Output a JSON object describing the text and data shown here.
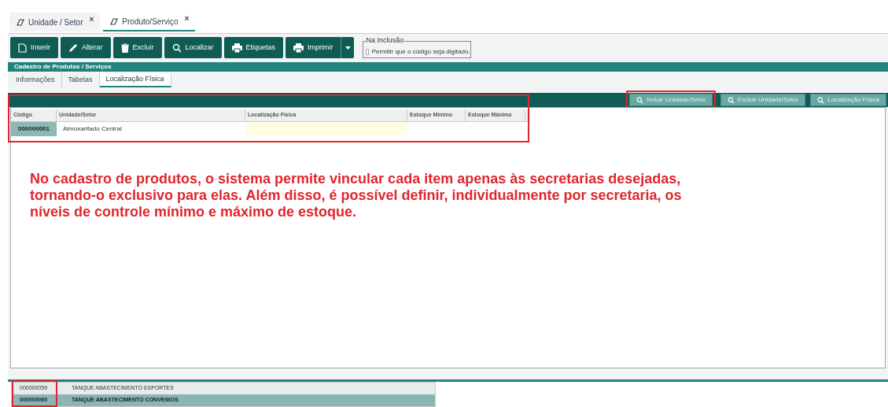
{
  "doc_tabs": [
    {
      "label": "Unidade / Setor",
      "close": "×",
      "selected": false
    },
    {
      "label": "Produto/Serviço",
      "close": "×",
      "selected": true
    }
  ],
  "toolbar": [
    {
      "kind": "doc",
      "label": "Inserir"
    },
    {
      "kind": "pencil",
      "label": "Alterar"
    },
    {
      "kind": "trash",
      "label": "Excluir"
    },
    {
      "kind": "search",
      "label": "Localizar"
    },
    {
      "kind": "printer",
      "label": "Etiquetas"
    },
    {
      "kind": "printer",
      "label": "Imprimir",
      "dropdown": true
    }
  ],
  "inclusion": {
    "legend": "Na Inclusão",
    "option": "Permitir que o código seja digitado.",
    "checked": false
  },
  "section_title": "Cadastro de Produtos / Serviços",
  "sub_tabs": [
    {
      "label": "Informações",
      "selected": false
    },
    {
      "label": "Tabelas",
      "selected": false
    },
    {
      "label": "Localização Física",
      "selected": true
    }
  ],
  "actions": [
    {
      "label": "Incluir Unidade/Setor",
      "highlighted": true
    },
    {
      "label": "Excluir Unidade/Setor",
      "highlighted": false
    },
    {
      "label": "Localização Física",
      "highlighted": false
    }
  ],
  "table": {
    "columns": [
      "Código",
      "Unidade/Setor",
      "Localização Física",
      "Estoque Mínimo",
      "Estoque Máximo"
    ],
    "rows": [
      [
        "000000001",
        "Almoxarifado Central",
        "",
        "",
        ""
      ]
    ]
  },
  "annotation": "No cadastro de produtos, o sistema permite vincular cada item apenas às secretarias desejadas, tornando-o exclusivo para elas. Além disso, é possível definir, individualmente por secretaria, os níveis de controle mínimo e máximo de estoque.",
  "bottom_rows": [
    {
      "code": "000000059",
      "name": "TANQUE ABASTECIMENTO ESPORTES",
      "selected": false
    },
    {
      "code": "000000060",
      "name": "TANQUE ABASTECIMENTO CONVENIOS",
      "selected": true
    }
  ]
}
